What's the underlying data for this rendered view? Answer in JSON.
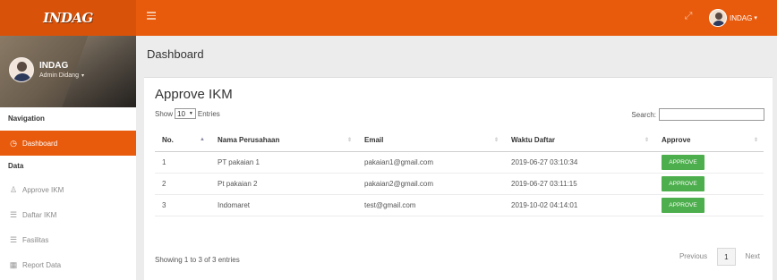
{
  "app": {
    "logo_text": "INDAG"
  },
  "topbar": {
    "user_name": "INDAG",
    "user_caret": "▾",
    "expand_icon": "expand-icon"
  },
  "sidebar": {
    "profile": {
      "name": "INDAG",
      "role": "Admin Didang",
      "role_caret": "▾"
    },
    "nav_header": "Navigation",
    "dashboard_label": "Dashboard",
    "data_header": "Data",
    "items": [
      {
        "label": "Approve IKM",
        "icon": "user-check-icon"
      },
      {
        "label": "Daftar IKM",
        "icon": "list-icon"
      },
      {
        "label": "Fasilitas",
        "icon": "list-icon"
      },
      {
        "label": "Report Data",
        "icon": "report-icon"
      }
    ]
  },
  "main": {
    "page_title": "Dashboard",
    "box_title": "Approve IKM",
    "show_prefix": "Show",
    "entries_value": "10",
    "show_suffix": "Entries",
    "search_label": "Search:",
    "search_value": "",
    "columns": [
      "No.",
      "Nama Perusahaan",
      "Email",
      "Waktu Daftar",
      "Approve"
    ],
    "rows": [
      {
        "no": "1",
        "nama": "PT pakaian 1",
        "email": "pakaian1@gmail.com",
        "waktu": "2019-06-27 03:10:34",
        "action": "APPROVE"
      },
      {
        "no": "2",
        "nama": "Pt pakaian 2",
        "email": "pakaian2@gmail.com",
        "waktu": "2019-06-27 03:11:15",
        "action": "APPROVE"
      },
      {
        "no": "3",
        "nama": "Indomaret",
        "email": "test@gmail.com",
        "waktu": "2019-10-02 04:14:01",
        "action": "APPROVE"
      }
    ],
    "showing_text": "Showing 1 to 3 of 3 entries",
    "pagination": {
      "previous": "Previous",
      "current": "1",
      "next": "Next"
    }
  },
  "colors": {
    "accent": "#e85a0c",
    "approve": "#4cae4c"
  }
}
